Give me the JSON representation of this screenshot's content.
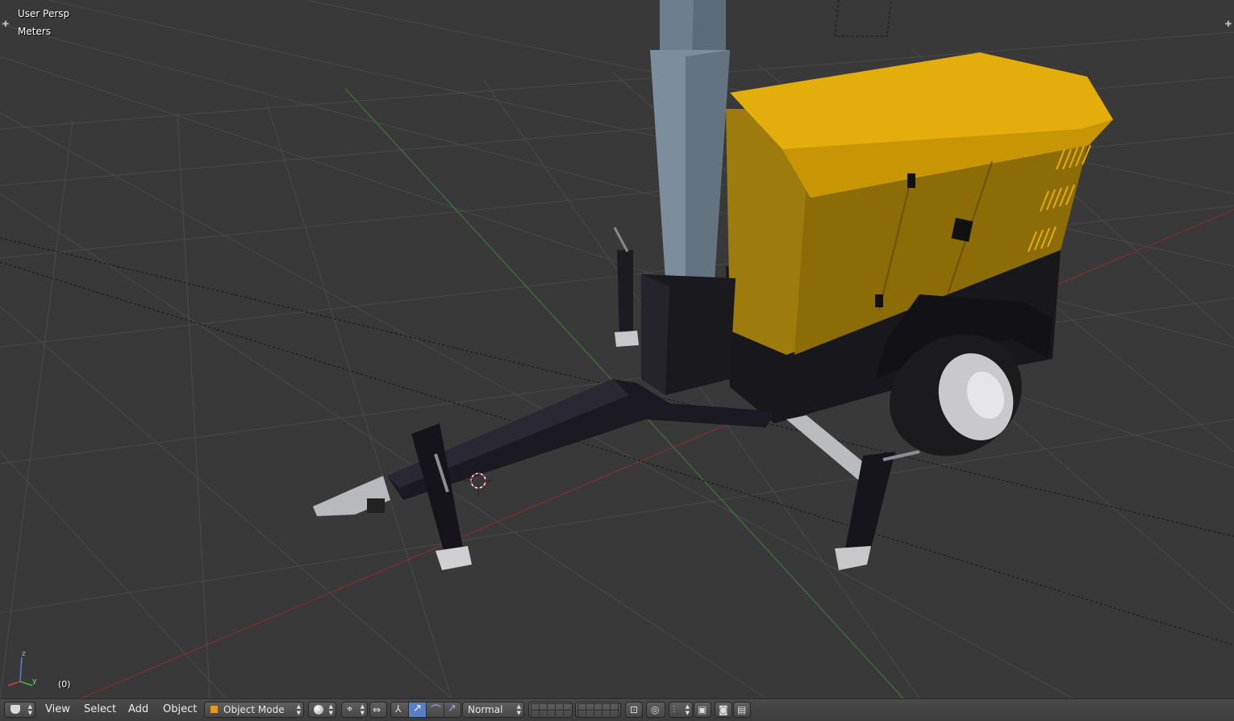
{
  "viewport": {
    "view_name": "User Persp",
    "units": "Meters",
    "frame": "(0)",
    "axis_labels": {
      "z": "z",
      "y": "y"
    }
  },
  "header": {
    "menu": {
      "view": "View",
      "select": "Select",
      "add": "Add",
      "object": "Object"
    },
    "mode": "Object Mode",
    "orientation": "Normal",
    "icons": {
      "editor_type": "cube-icon",
      "shading": "sphere-icon",
      "pivot": "pivot-icon",
      "mode_icon": "object-cube-icon"
    }
  },
  "colors": {
    "viewport_bg": "#393939",
    "grid": "#4a4a4a",
    "x_axis": "#8c2f2f",
    "y_axis": "#3f7d3f",
    "yellow_body": "#e0a900",
    "header_bg": "#444444",
    "active_blue": "#5680c2"
  }
}
